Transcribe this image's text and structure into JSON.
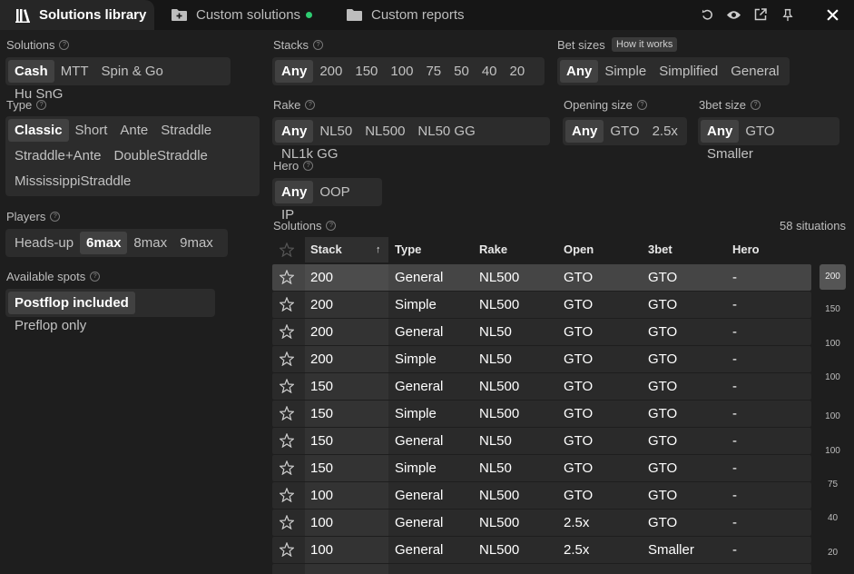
{
  "tabs": {
    "solutions_library": "Solutions library",
    "custom_solutions": "Custom solutions",
    "custom_reports": "Custom reports"
  },
  "filters": {
    "solutions": {
      "label": "Solutions",
      "options": [
        "Cash",
        "MTT",
        "Spin & Go",
        "Hu SnG"
      ],
      "selected": "Cash"
    },
    "type": {
      "label": "Type",
      "options": [
        "Classic",
        "Short",
        "Ante",
        "Straddle",
        "Straddle+Ante",
        "DoubleStraddle",
        "MississippiStraddle"
      ],
      "selected": "Classic"
    },
    "players": {
      "label": "Players",
      "options": [
        "Heads-up",
        "6max",
        "8max",
        "9max"
      ],
      "selected": "6max"
    },
    "available_spots": {
      "label": "Available spots",
      "options": [
        "Postflop included",
        "Preflop only"
      ],
      "selected": "Postflop included"
    },
    "stacks": {
      "label": "Stacks",
      "options": [
        "Any",
        "200",
        "150",
        "100",
        "75",
        "50",
        "40",
        "20"
      ],
      "selected": "Any"
    },
    "bet_sizes": {
      "label": "Bet sizes",
      "badge": "How it works",
      "options": [
        "Any",
        "Simple",
        "Simplified",
        "General"
      ],
      "selected": "Any"
    },
    "rake": {
      "label": "Rake",
      "options": [
        "Any",
        "NL50",
        "NL500",
        "NL50 GG",
        "NL1k GG"
      ],
      "selected": "Any"
    },
    "opening_size": {
      "label": "Opening size",
      "options": [
        "Any",
        "GTO",
        "2.5x"
      ],
      "selected": "Any"
    },
    "threebet_size": {
      "label": "3bet size",
      "options": [
        "Any",
        "GTO",
        "Smaller"
      ],
      "selected": "Any"
    },
    "hero": {
      "label": "Hero",
      "options": [
        "Any",
        "OOP",
        "IP"
      ],
      "selected": "Any"
    }
  },
  "solutions": {
    "label": "Solutions",
    "count": "58 situations",
    "columns": [
      "Stack",
      "Type",
      "Rake",
      "Open",
      "3bet",
      "Hero"
    ],
    "rows": [
      [
        "200",
        "General",
        "NL500",
        "GTO",
        "GTO",
        "-"
      ],
      [
        "200",
        "Simple",
        "NL500",
        "GTO",
        "GTO",
        "-"
      ],
      [
        "200",
        "General",
        "NL50",
        "GTO",
        "GTO",
        "-"
      ],
      [
        "200",
        "Simple",
        "NL50",
        "GTO",
        "GTO",
        "-"
      ],
      [
        "150",
        "General",
        "NL500",
        "GTO",
        "GTO",
        "-"
      ],
      [
        "150",
        "Simple",
        "NL500",
        "GTO",
        "GTO",
        "-"
      ],
      [
        "150",
        "General",
        "NL50",
        "GTO",
        "GTO",
        "-"
      ],
      [
        "150",
        "Simple",
        "NL50",
        "GTO",
        "GTO",
        "-"
      ],
      [
        "100",
        "General",
        "NL500",
        "GTO",
        "GTO",
        "-"
      ],
      [
        "100",
        "General",
        "NL500",
        "2.5x",
        "GTO",
        "-"
      ],
      [
        "100",
        "General",
        "NL500",
        "2.5x",
        "Smaller",
        "-"
      ]
    ],
    "scroll_labels": [
      "200",
      "150",
      "100",
      "100",
      "100",
      "100",
      "75",
      "40",
      "20"
    ]
  }
}
